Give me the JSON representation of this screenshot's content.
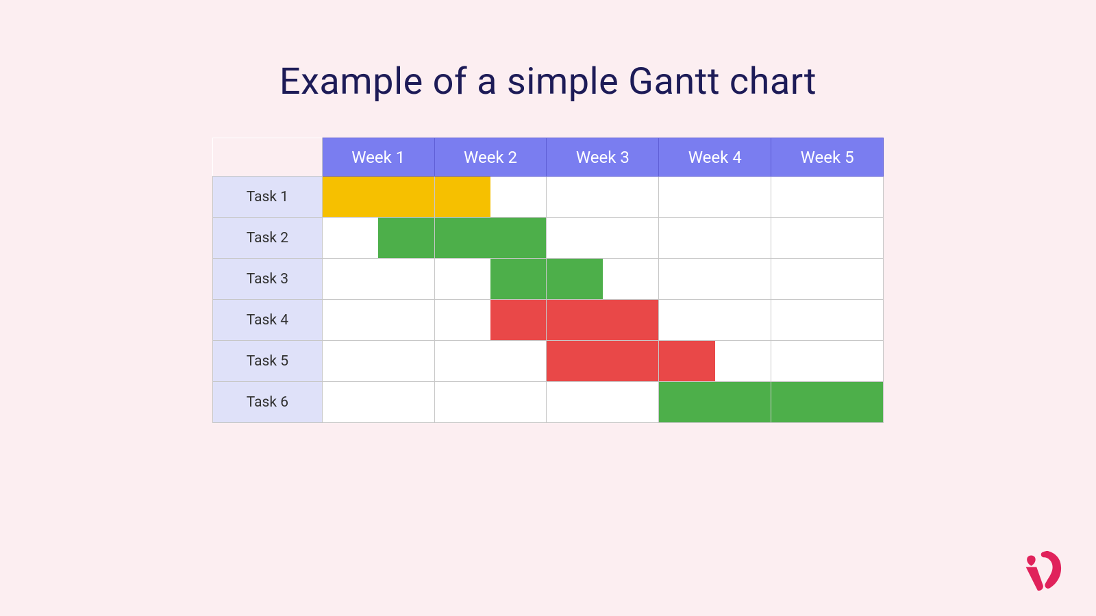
{
  "title": "Example of a simple Gantt chart",
  "colors": {
    "yellow": "#f6c000",
    "green": "#4daf4a",
    "red": "#e94848"
  },
  "chart_data": {
    "type": "bar",
    "title": "Example of a simple Gantt chart",
    "xlabel": "",
    "ylabel": "",
    "categories": [
      "Week 1",
      "Week 2",
      "Week 3",
      "Week 4",
      "Week 5"
    ],
    "x_unit": "week",
    "series": [
      {
        "name": "Task 1",
        "start": 0.0,
        "end": 1.5,
        "color": "yellow"
      },
      {
        "name": "Task 2",
        "start": 0.5,
        "end": 2.0,
        "color": "green"
      },
      {
        "name": "Task 3",
        "start": 1.5,
        "end": 2.5,
        "color": "green"
      },
      {
        "name": "Task 4",
        "start": 1.5,
        "end": 3.0,
        "color": "red"
      },
      {
        "name": "Task 5",
        "start": 2.0,
        "end": 3.5,
        "color": "red"
      },
      {
        "name": "Task 6",
        "start": 3.0,
        "end": 5.0,
        "color": "green"
      }
    ],
    "xlim": [
      0,
      5
    ]
  }
}
